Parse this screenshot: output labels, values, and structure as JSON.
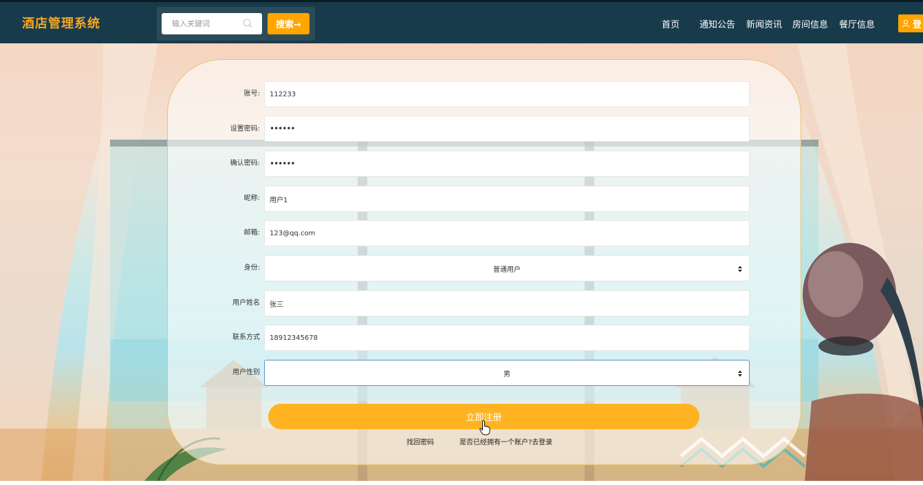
{
  "header": {
    "logo": "酒店管理系统",
    "search_placeholder": "输入关键词",
    "search_button": "搜索→",
    "nav": [
      "首页",
      "通知公告",
      "新闻资讯",
      "房间信息",
      "餐厅信息"
    ],
    "login_label": "登"
  },
  "form": {
    "fields": [
      {
        "label": "账号:",
        "value": "112233"
      },
      {
        "label": "设置密码:",
        "value": "••••••"
      },
      {
        "label": "确认密码:",
        "value": "••••••"
      },
      {
        "label": "昵称:",
        "value": "用户1"
      },
      {
        "label": "邮箱:",
        "value": "123@qq.com"
      },
      {
        "label": "身份:",
        "value": "普通用户"
      },
      {
        "label": "用户姓名",
        "value": "张三"
      },
      {
        "label": "联系方式",
        "value": "18912345678"
      },
      {
        "label": "用户性别",
        "value": "男"
      }
    ],
    "submit_label": "立即注册",
    "forgot_link": "找回密码",
    "login_link": "是否已经拥有一个账户?去登录"
  },
  "colors": {
    "topbar": "#183b4b",
    "accent": "#ffa500",
    "logo": "#f5a623"
  }
}
